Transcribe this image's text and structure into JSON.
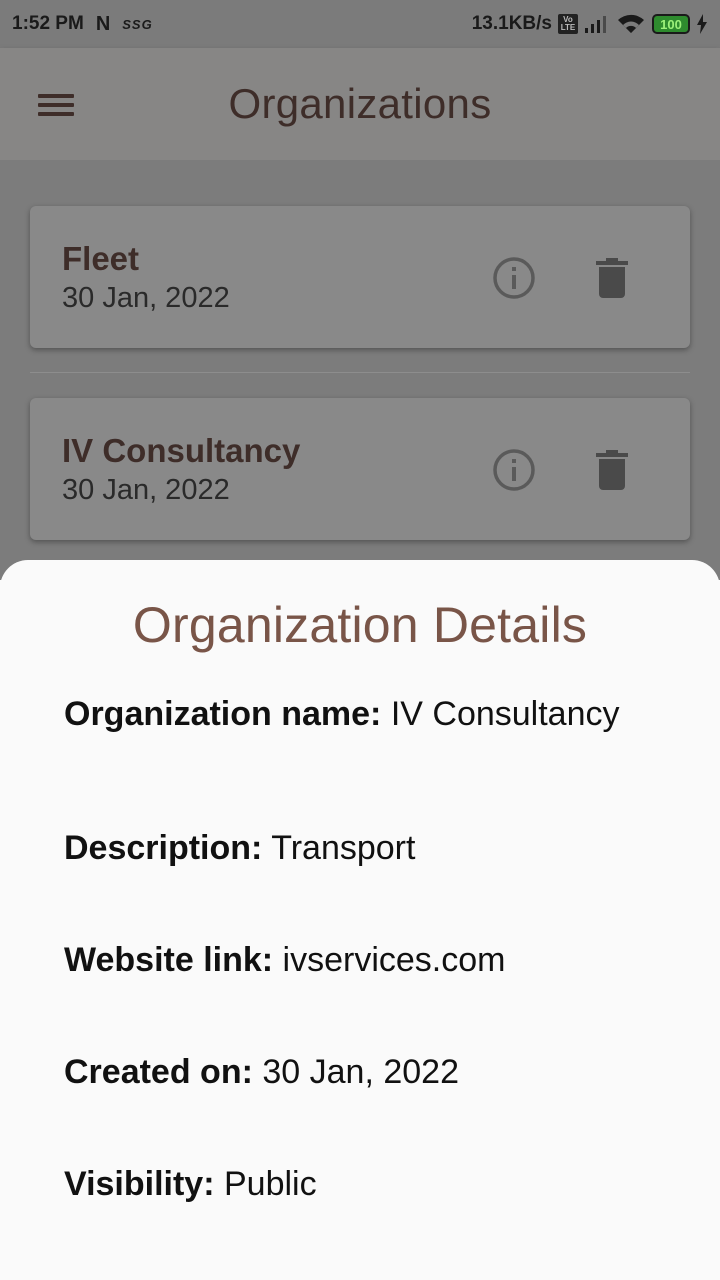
{
  "status_bar": {
    "time": "1:52 PM",
    "notif_1": "N",
    "notif_2": "SSG",
    "speed": "13.1KB/s",
    "volte_top": "Vo",
    "volte_bottom": "LTE",
    "battery": "100",
    "icons": [
      "signal-icon",
      "wifi-icon",
      "battery-icon",
      "charging-icon"
    ]
  },
  "app_bar": {
    "title": "Organizations",
    "menu_icon": "hamburger-menu-icon"
  },
  "organizations": [
    {
      "name": "Fleet",
      "date": "30 Jan, 2022"
    },
    {
      "name": "IV Consultancy",
      "date": "30 Jan, 2022"
    }
  ],
  "details": {
    "title": "Organization Details",
    "name_label": "Organization name:",
    "name_value": "IV Consultancy",
    "description_label": "Description:",
    "description_value": "Transport",
    "website_label": "Website link:",
    "website_value": "ivservices.com",
    "created_label": "Created on:",
    "created_value": "30 Jan, 2022",
    "visibility_label": "Visibility:",
    "visibility_value": "Public"
  },
  "colors": {
    "accent_brown": "#795548",
    "dark_brown": "#3e2d29",
    "scrim": "#7c7c7c"
  }
}
